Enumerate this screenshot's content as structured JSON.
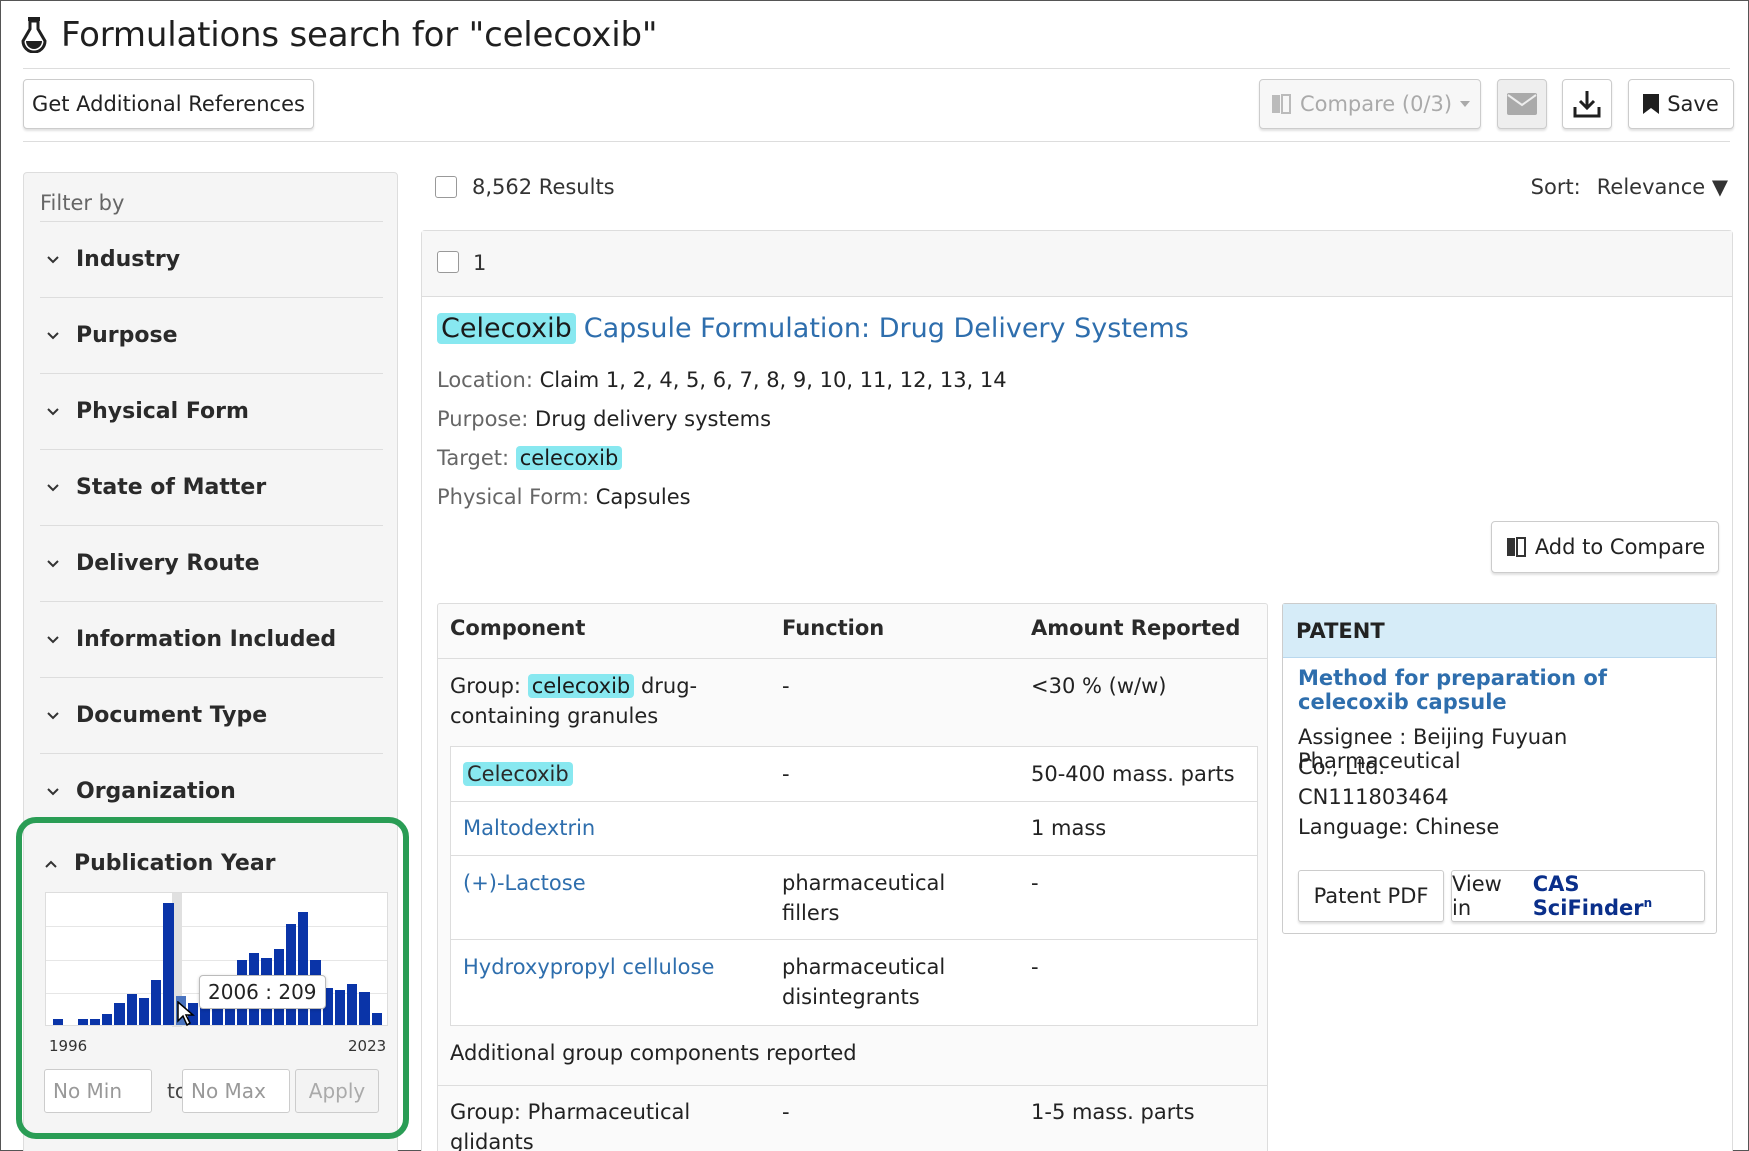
{
  "header": {
    "title": "Formulations search for \"celecoxib\""
  },
  "toolbar": {
    "get_refs_label": "Get Additional References",
    "compare_label": "Compare (0/3)",
    "save_label": "Save"
  },
  "sidebar": {
    "filter_label": "Filter by",
    "facets": [
      "Industry",
      "Purpose",
      "Physical Form",
      "State of Matter",
      "Delivery Route",
      "Information Included",
      "Document Type",
      "Organization"
    ],
    "publication_year": {
      "label": "Publication Year",
      "min_year": "1996",
      "max_year": "2023",
      "tooltip": "2006 : 209",
      "min_placeholder": "No Min",
      "max_placeholder": "No Max",
      "to_label": "to",
      "apply_label": "Apply",
      "bar_heights": [
        0.05,
        0,
        0.05,
        0.05,
        0.09,
        0.18,
        0.25,
        0.22,
        0.37,
        1.0,
        0.24,
        0.18,
        0.2,
        0.27,
        0.33,
        0.53,
        0.59,
        0.55,
        0.62,
        0.83,
        0.93,
        0.53,
        0.3,
        0.29,
        0.34,
        0.27,
        0.1
      ]
    }
  },
  "results": {
    "count_label": "8,562 Results",
    "sort_label": "Sort:",
    "sort_value": "Relevance ▼"
  },
  "result1": {
    "index": "1",
    "title_highlight": "Celecoxib",
    "title_rest": "Capsule Formulation: Drug Delivery Systems",
    "location_key": "Location:",
    "location_val": "Claim 1, 2, 4, 5, 6, 7, 8, 9, 10, 11, 12, 13, 14",
    "purpose_key": "Purpose:",
    "purpose_val": "Drug delivery systems",
    "target_key": "Target:",
    "target_val": "celecoxib",
    "form_key": "Physical Form:",
    "form_val": "Capsules",
    "add_compare_label": "Add to Compare",
    "table": {
      "headers": [
        "Component",
        "Function",
        "Amount Reported"
      ],
      "group1_prefix": "Group:",
      "group1_highlight": "celecoxib",
      "group1_line1_rest": "drug-",
      "group1_line2": "containing granules",
      "group1_function": "-",
      "group1_amount": "<30 % (w/w)",
      "rows": [
        {
          "component": "Celecoxib",
          "function": "-",
          "amount": "50-400 mass. parts"
        },
        {
          "component": "Maltodextrin",
          "function": "",
          "amount": "1 mass"
        },
        {
          "component": "(+)-Lactose",
          "function_l1": "pharmaceutical",
          "function_l2": "fillers",
          "amount": "-"
        },
        {
          "component": "Hydroxypropyl cellulose",
          "function_l1": "pharmaceutical",
          "function_l2": "disintegrants",
          "amount": "-"
        }
      ],
      "additional_label": "Additional group components reported",
      "group2_l1": "Group: Pharmaceutical",
      "group2_l2": "glidants",
      "group2_function": "-",
      "group2_amount": "1-5 mass. parts"
    },
    "patent": {
      "header": "PATENT",
      "title": "Method for preparation of celecoxib capsule",
      "assignee_l1": "Assignee : Beijing Fuyuan Pharmaceutical",
      "assignee_l2": "Co., Ltd.",
      "number": "CN111803464",
      "language": "Language: Chinese",
      "pdf_label": "Patent PDF",
      "view_label": "View in",
      "cas_label": "CAS SciFinder",
      "cas_sup": "n"
    }
  },
  "colors": {
    "link": "#2e6ead",
    "highlight": "#88e8f0",
    "bar": "#0a34a8",
    "focus_ring": "#2a9d55",
    "patent_header": "#d6ecf8"
  }
}
